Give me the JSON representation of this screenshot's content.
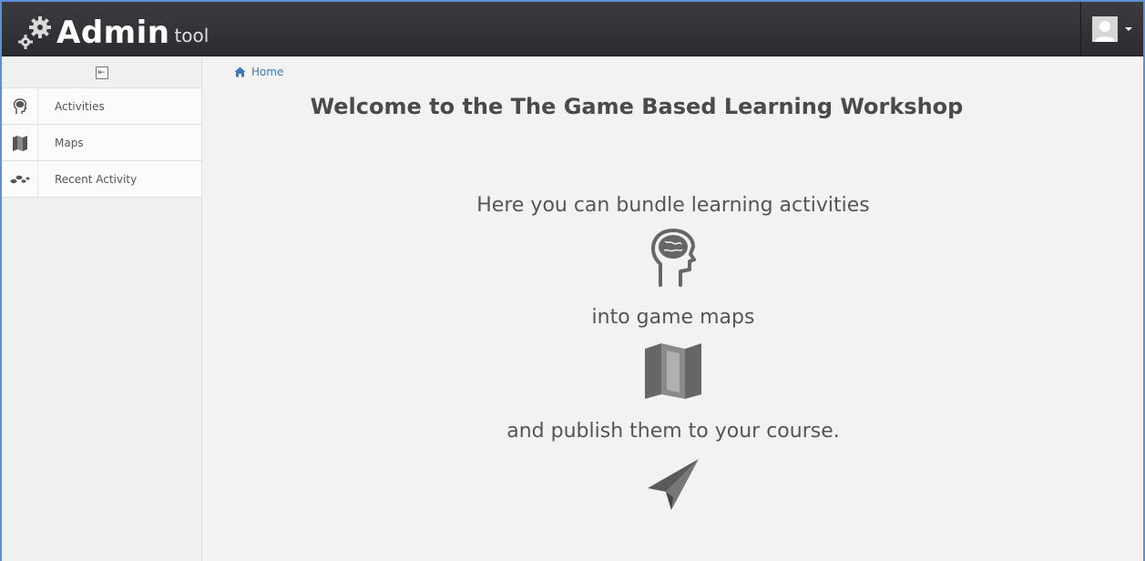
{
  "header": {
    "brand_main": "Admin",
    "brand_sub": "tool"
  },
  "sidebar": {
    "items": [
      {
        "label": "Activities",
        "icon": "head-icon"
      },
      {
        "label": "Maps",
        "icon": "map-icon"
      },
      {
        "label": "Recent Activity",
        "icon": "footsteps-icon"
      }
    ]
  },
  "breadcrumb": {
    "home_label": "Home"
  },
  "main": {
    "title": "Welcome to the The Game Based Learning Workshop",
    "line1": "Here you can bundle learning activities",
    "line2": "into game maps",
    "line3": "and publish them to your course."
  },
  "colors": {
    "navbar": "#2f2f33",
    "link": "#3a7ab8",
    "text": "#555555",
    "frame_border": "#5b8fd6"
  }
}
